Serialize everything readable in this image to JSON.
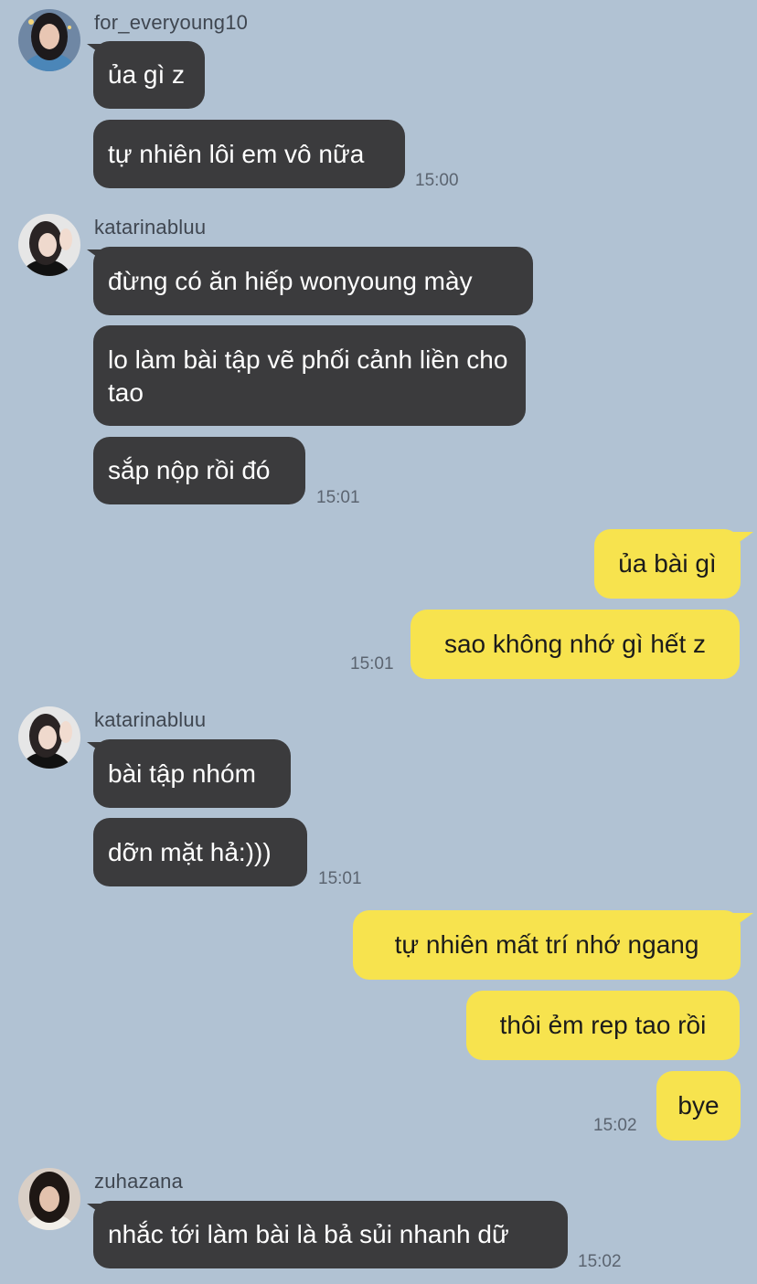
{
  "groups": [
    {
      "sender": "for_everyoung10",
      "avatar_icon": "profile-photo-avatar",
      "messages": [
        "ủa gì z",
        "tự nhiên lôi em vô nữa"
      ],
      "time": "15:00"
    },
    {
      "sender": "katarinabluu",
      "avatar_icon": "profile-photo-avatar",
      "messages": [
        "đừng có ăn hiếp wonyoung mày",
        "lo làm bài tập vẽ phối cảnh liền cho tao",
        "sắp nộp rồi đó"
      ],
      "time": "15:01"
    },
    {
      "sender": "me",
      "messages": [
        "ủa bài gì",
        "sao không nhớ gì hết z"
      ],
      "time": "15:01"
    },
    {
      "sender": "katarinabluu",
      "avatar_icon": "profile-photo-avatar",
      "messages": [
        "bài tập nhóm",
        "dỡn mặt hả:)))"
      ],
      "time": "15:01"
    },
    {
      "sender": "me",
      "messages": [
        "tự nhiên mất trí nhớ ngang",
        "thôi ẻm rep tao rồi",
        "bye"
      ],
      "time": "15:02"
    },
    {
      "sender": "zuhazana",
      "avatar_icon": "profile-photo-avatar",
      "messages": [
        "nhắc tới làm bài là bả sủi nhanh dữ"
      ],
      "time": "15:02"
    }
  ],
  "colors": {
    "background": "#b1c2d3",
    "incoming_bubble": "#3b3b3d",
    "outgoing_bubble": "#f7e34e",
    "timestamp": "#5b6470"
  }
}
